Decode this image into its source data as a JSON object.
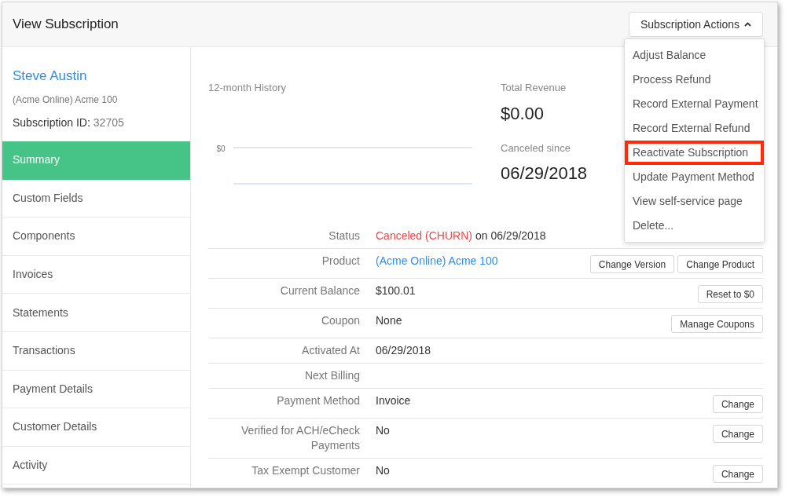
{
  "header": {
    "title": "View Subscription",
    "actions": {
      "label": "Subscription Actions",
      "expanded": true
    }
  },
  "menu": {
    "items": [
      {
        "label": "Adjust Balance",
        "highlighted": false
      },
      {
        "label": "Process Refund",
        "highlighted": false
      },
      {
        "label": "Record External Payment",
        "highlighted": false
      },
      {
        "label": "Record External Refund",
        "highlighted": false
      },
      {
        "label": "Reactivate Subscription",
        "highlighted": true
      },
      {
        "label": "Update Payment Method",
        "highlighted": false
      },
      {
        "label": "View self-service page",
        "highlighted": false
      },
      {
        "label": "Delete...",
        "highlighted": false
      }
    ]
  },
  "customer": {
    "name": "Steve Austin",
    "product": "(Acme Online) Acme 100",
    "id_label": "Subscription ID:",
    "id": "32705"
  },
  "sidebar": {
    "items": [
      {
        "label": "Summary",
        "selected": true
      },
      {
        "label": "Custom Fields",
        "selected": false
      },
      {
        "label": "Components",
        "selected": false
      },
      {
        "label": "Invoices",
        "selected": false
      },
      {
        "label": "Statements",
        "selected": false
      },
      {
        "label": "Transactions",
        "selected": false
      },
      {
        "label": "Payment Details",
        "selected": false
      },
      {
        "label": "Customer Details",
        "selected": false
      },
      {
        "label": "Activity",
        "selected": false
      }
    ]
  },
  "history": {
    "title": "12-month History",
    "y_label": "$0"
  },
  "stats": [
    {
      "label": "Total Revenue",
      "value": "$0.00"
    },
    {
      "label": "Canceled since",
      "value": "06/29/2018"
    }
  ],
  "details": [
    {
      "kind": "status",
      "label": "Status",
      "value": "Canceled (CHURN)",
      "suffix": "on 06/29/2018"
    },
    {
      "kind": "link",
      "label": "Product",
      "value": "(Acme Online) Acme 100",
      "buttons": [
        "Change Version",
        "Change Product"
      ]
    },
    {
      "kind": "text",
      "label": "Current Balance",
      "value": "$100.01",
      "buttons": [
        "Reset to $0"
      ]
    },
    {
      "kind": "text",
      "label": "Coupon",
      "value": "None",
      "buttons": [
        "Manage Coupons"
      ]
    },
    {
      "kind": "text",
      "label": "Activated At",
      "value": "06/29/2018"
    },
    {
      "kind": "text",
      "label": "Next Billing"
    },
    {
      "kind": "text",
      "label": "Payment Method",
      "value": "Invoice",
      "buttons": [
        "Change"
      ]
    },
    {
      "kind": "text",
      "label": "Verified for ACH/eCheck Payments",
      "value": "No",
      "buttons": [
        "Change"
      ]
    },
    {
      "kind": "text",
      "label": "Tax Exempt Customer",
      "value": "No",
      "buttons": [
        "Change"
      ]
    }
  ]
}
